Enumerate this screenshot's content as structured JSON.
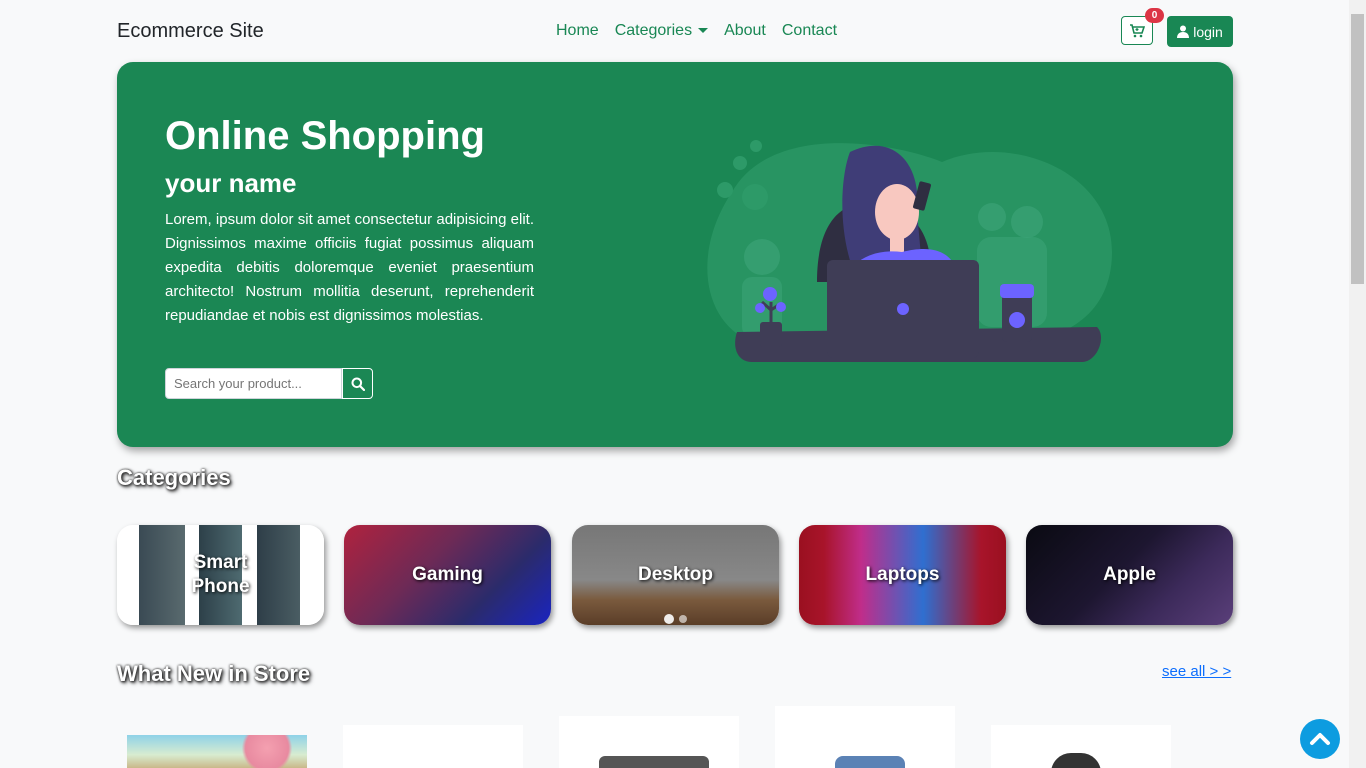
{
  "navbar": {
    "brand": "Ecommerce Site",
    "links": [
      "Home",
      "Categories",
      "About",
      "Contact"
    ],
    "cart_count": "0",
    "login_label": "login",
    "accent": "#198754"
  },
  "hero": {
    "title": "Online Shopping",
    "subtitle": "your name",
    "text": "Lorem, ipsum dolor sit amet consectetur adipisicing elit. Dignissimos maxime officiis fugiat possimus aliquam expedita debitis doloremque eveniet praesentium architecto! Nostrum mollitia deserunt, reprehenderit repudiandae et nobis est dignissimos molestias.",
    "search_placeholder": "Search your product...",
    "background": "#1b8754"
  },
  "categories": {
    "title": "Categories",
    "items": [
      {
        "label": "Smart Phone"
      },
      {
        "label": "Gaming"
      },
      {
        "label": "Desktop"
      },
      {
        "label": "Laptops"
      },
      {
        "label": "Apple"
      }
    ]
  },
  "whats_new": {
    "title": "What New in Store",
    "see_all": "see all > >"
  }
}
